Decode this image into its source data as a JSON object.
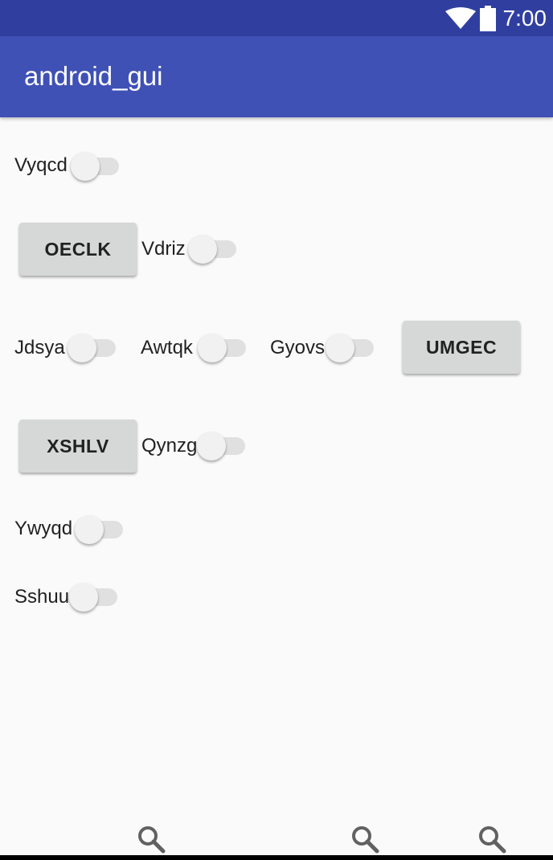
{
  "status_bar": {
    "time": "7:00",
    "icons": [
      "wifi-icon",
      "battery-icon"
    ]
  },
  "app_bar": {
    "title": "android_gui"
  },
  "rows": {
    "r1": {
      "switch_label": "Vyqcd"
    },
    "r2": {
      "button": "OECLK",
      "switch_label": "Vdriz"
    },
    "r3": {
      "switch_labels": [
        "Jdsya",
        "Awtqk",
        "Gyovs"
      ],
      "button": "UMGEC"
    },
    "r4": {
      "button": "XSHLV",
      "switch_label": "Qynzg"
    },
    "r5": {
      "switch_label": "Ywyqd"
    },
    "r6": {
      "switch_label": "Sshuu"
    }
  },
  "switch_states": {
    "all": "off"
  },
  "bottom_icons": [
    "search-icon",
    "search-icon",
    "search-icon"
  ],
  "colors": {
    "status_bar": "#303f9f",
    "app_bar": "#3f51b5",
    "background": "#fafafa",
    "button": "#d6d7d7"
  }
}
